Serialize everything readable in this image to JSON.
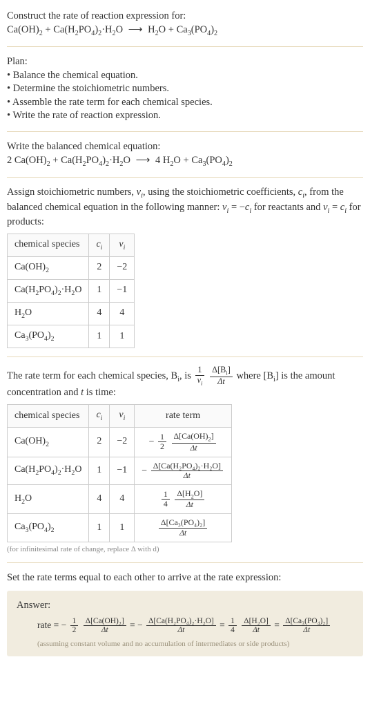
{
  "intro": {
    "prompt": "Construct the rate of reaction expression for:",
    "equation_lhs1": "Ca(OH)",
    "equation_lhs1_sub": "2",
    "plus1": " + ",
    "equation_lhs2a": "Ca(H",
    "equation_lhs2a_sub": "2",
    "equation_lhs2b": "PO",
    "equation_lhs2b_sub": "4",
    "equation_lhs2c": ")",
    "equation_lhs2c_sub": "2",
    "equation_lhs2d": "·H",
    "equation_lhs2d_sub": "2",
    "equation_lhs2e": "O",
    "arrow": "⟶",
    "equation_rhs1": "H",
    "equation_rhs1_sub": "2",
    "equation_rhs1b": "O",
    "plus2": " + ",
    "equation_rhs2a": "Ca",
    "equation_rhs2a_sub": "3",
    "equation_rhs2b": "(PO",
    "equation_rhs2b_sub": "4",
    "equation_rhs2c": ")",
    "equation_rhs2c_sub": "2"
  },
  "plan": {
    "heading": "Plan:",
    "b1": "• Balance the chemical equation.",
    "b2": "• Determine the stoichiometric numbers.",
    "b3": "• Assemble the rate term for each chemical species.",
    "b4": "• Write the rate of reaction expression."
  },
  "balanced": {
    "heading": "Write the balanced chemical equation:",
    "c1": "2 Ca(OH)",
    "c1_sub": "2",
    "plus1": " + ",
    "c2a": "Ca(H",
    "c2a_sub": "2",
    "c2b": "PO",
    "c2b_sub": "4",
    "c2c": ")",
    "c2c_sub": "2",
    "c2d": "·H",
    "c2d_sub": "2",
    "c2e": "O",
    "arrow": "⟶",
    "c3": "4 H",
    "c3_sub": "2",
    "c3b": "O",
    "plus2": " + ",
    "c4a": "Ca",
    "c4a_sub": "3",
    "c4b": "(PO",
    "c4b_sub": "4",
    "c4c": ")",
    "c4c_sub": "2"
  },
  "assign": {
    "t1": "Assign stoichiometric numbers, ",
    "nu": "ν",
    "nu_sub": "i",
    "t2": ", using the stoichiometric coefficients, ",
    "c": "c",
    "c_sub": "i",
    "t3": ", from the balanced chemical equation in the following manner: ",
    "eq1_lhs": "ν",
    "eq1_lhs_sub": "i",
    "eq1": " = −",
    "eq1_rhs": "c",
    "eq1_rhs_sub": "i",
    "t4": " for reactants and ",
    "eq2_lhs": "ν",
    "eq2_lhs_sub": "i",
    "eq2": " = ",
    "eq2_rhs": "c",
    "eq2_rhs_sub": "i",
    "t5": " for products:"
  },
  "table1": {
    "h_species": "chemical species",
    "h_c": "c",
    "h_c_sub": "i",
    "h_nu": "ν",
    "h_nu_sub": "i",
    "rows": [
      {
        "sp_a": "Ca(OH)",
        "sp_a_sub": "2",
        "sp_b": "",
        "sp_b_sub": "",
        "sp_c": "",
        "sp_c_sub": "",
        "sp_d": "",
        "sp_d_sub": "",
        "sp_e": "",
        "c": "2",
        "nu": "−2"
      },
      {
        "sp_a": "Ca(H",
        "sp_a_sub": "2",
        "sp_b": "PO",
        "sp_b_sub": "4",
        "sp_c": ")",
        "sp_c_sub": "2",
        "sp_d": "·H",
        "sp_d_sub": "2",
        "sp_e": "O",
        "c": "1",
        "nu": "−1"
      },
      {
        "sp_a": "H",
        "sp_a_sub": "2",
        "sp_b": "O",
        "sp_b_sub": "",
        "sp_c": "",
        "sp_c_sub": "",
        "sp_d": "",
        "sp_d_sub": "",
        "sp_e": "",
        "c": "4",
        "nu": "4"
      },
      {
        "sp_a": "Ca",
        "sp_a_sub": "3",
        "sp_b": "(PO",
        "sp_b_sub": "4",
        "sp_c": ")",
        "sp_c_sub": "2",
        "sp_d": "",
        "sp_d_sub": "",
        "sp_e": "",
        "c": "1",
        "nu": "1"
      }
    ]
  },
  "rateterm_intro": {
    "t1": "The rate term for each chemical species, B",
    "t1_sub": "i",
    "t2": ", is ",
    "f1_num": "1",
    "f1_den_a": "ν",
    "f1_den_sub": "i",
    "f2_num_a": "Δ[B",
    "f2_num_sub": "i",
    "f2_num_b": "]",
    "f2_den": "Δt",
    "t3": " where [B",
    "t3_sub": "i",
    "t4": "] is the amount concentration and ",
    "t5": "t",
    "t6": " is time:"
  },
  "table2": {
    "h_species": "chemical species",
    "h_c": "c",
    "h_c_sub": "i",
    "h_nu": "ν",
    "h_nu_sub": "i",
    "h_rate": "rate term",
    "rows": [
      {
        "sp_a": "Ca(OH)",
        "sp_a_sub": "2",
        "sp_b": "",
        "sp_b_sub": "",
        "sp_c": "",
        "sp_c_sub": "",
        "sp_d": "",
        "sp_d_sub": "",
        "sp_e": "",
        "c": "2",
        "nu": "−2",
        "pre": "−",
        "co_num": "1",
        "co_den": "2",
        "rt_num_a": "Δ[Ca(OH)",
        "rt_num_sub": "2",
        "rt_num_b": "]",
        "rt_den": "Δt"
      },
      {
        "sp_a": "Ca(H",
        "sp_a_sub": "2",
        "sp_b": "PO",
        "sp_b_sub": "4",
        "sp_c": ")",
        "sp_c_sub": "2",
        "sp_d": "·H",
        "sp_d_sub": "2",
        "sp_e": "O",
        "c": "1",
        "nu": "−1",
        "pre": "−",
        "co_num": "",
        "co_den": "",
        "rt_num_a": "Δ[Ca(H₂PO₄)₂·H₂O]",
        "rt_num_sub": "",
        "rt_num_b": "",
        "rt_den": "Δt"
      },
      {
        "sp_a": "H",
        "sp_a_sub": "2",
        "sp_b": "O",
        "sp_b_sub": "",
        "sp_c": "",
        "sp_c_sub": "",
        "sp_d": "",
        "sp_d_sub": "",
        "sp_e": "",
        "c": "4",
        "nu": "4",
        "pre": "",
        "co_num": "1",
        "co_den": "4",
        "rt_num_a": "Δ[H",
        "rt_num_sub": "2",
        "rt_num_b": "O]",
        "rt_den": "Δt"
      },
      {
        "sp_a": "Ca",
        "sp_a_sub": "3",
        "sp_b": "(PO",
        "sp_b_sub": "4",
        "sp_c": ")",
        "sp_c_sub": "2",
        "sp_d": "",
        "sp_d_sub": "",
        "sp_e": "",
        "c": "1",
        "nu": "1",
        "pre": "",
        "co_num": "",
        "co_den": "",
        "rt_num_a": "Δ[Ca₃(PO₄)₂]",
        "rt_num_sub": "",
        "rt_num_b": "",
        "rt_den": "Δt"
      }
    ],
    "note": "(for infinitesimal rate of change, replace Δ with d)"
  },
  "setequal": "Set the rate terms equal to each other to arrive at the rate expression:",
  "answer": {
    "label": "Answer:",
    "rate_prefix": "rate = −",
    "term1_co_num": "1",
    "term1_co_den": "2",
    "term1_num": "Δ[Ca(OH)₂]",
    "term1_den": "Δt",
    "eq1": " = −",
    "term2_num": "Δ[Ca(H₂PO₄)₂·H₂O]",
    "term2_den": "Δt",
    "eq2": " = ",
    "term3_co_num": "1",
    "term3_co_den": "4",
    "term3_num": "Δ[H₂O]",
    "term3_den": "Δt",
    "eq3": " = ",
    "term4_num": "Δ[Ca₃(PO₄)₂]",
    "term4_den": "Δt",
    "note": "(assuming constant volume and no accumulation of intermediates or side products)"
  }
}
